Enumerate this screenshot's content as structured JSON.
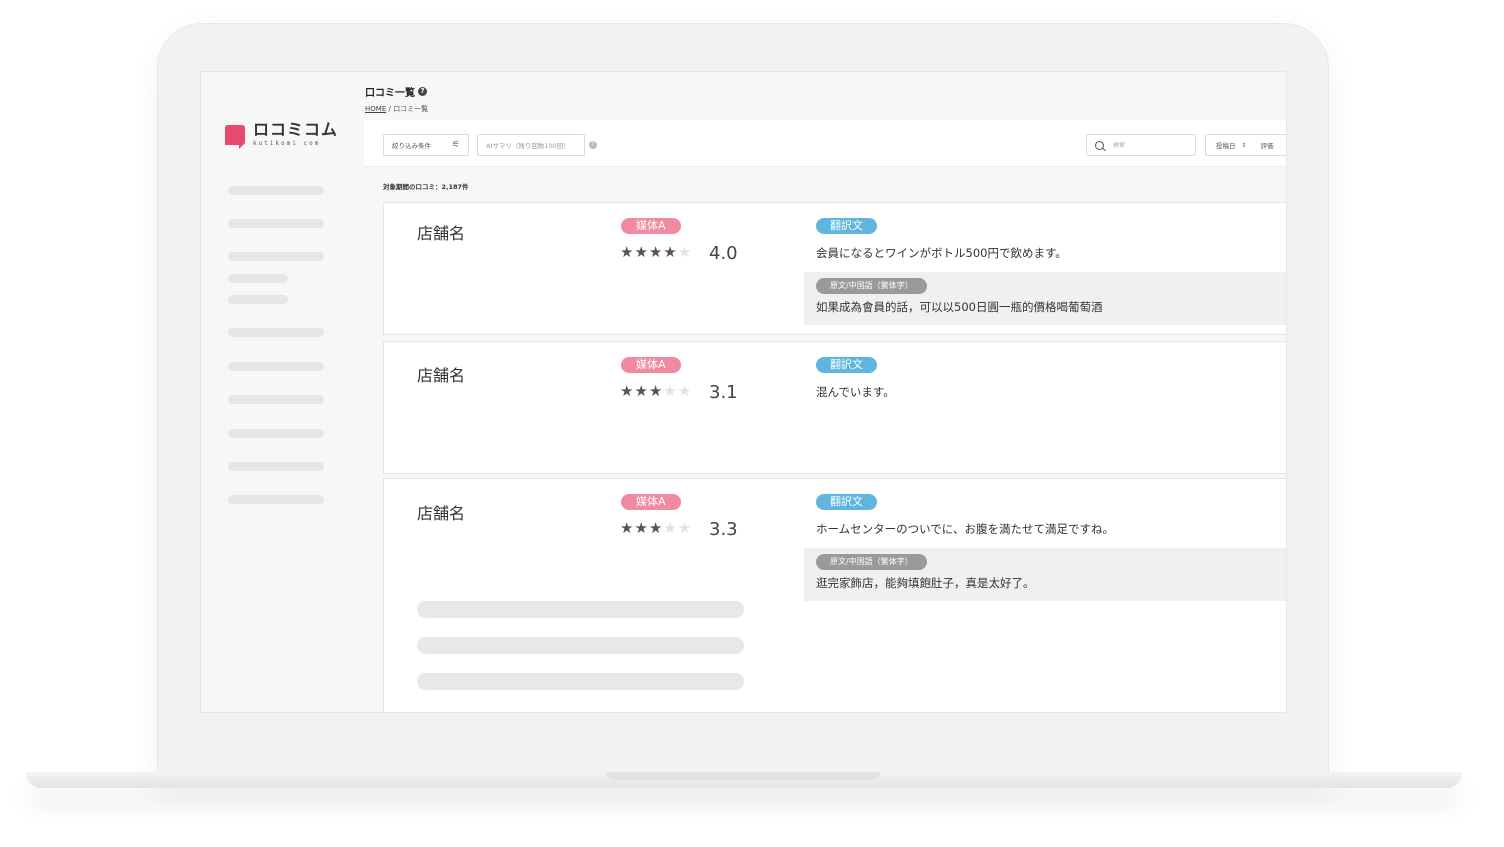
{
  "brand": {
    "logo_main": "ロコミコム",
    "logo_sub": "kutikomi com",
    "accent": "#e84a6f"
  },
  "header": {
    "title": "口コミ一覧",
    "help_icon": "?",
    "breadcrumb_home": "HOME",
    "breadcrumb_sep": "/",
    "breadcrumb_current": "口コミ一覧"
  },
  "toolbar": {
    "filter_label": "絞り込み条件",
    "filter_icon": "⚟",
    "ai_summary_label": "AIサマリ（残り回数100回）",
    "ai_help_icon": "?",
    "search_placeholder": "検索",
    "sort_label": "投稿日",
    "sort_arrows": "⇕",
    "sort_rating": "評価"
  },
  "content": {
    "count_label": "対象期間の口コミ：2,187件"
  },
  "reviews": [
    {
      "shop": "店舗名",
      "media": "媒体A",
      "rating": "4.0",
      "stars_filled": 4,
      "translation_label": "翻訳文",
      "translation": "会員になるとワインがボトル500円で飲めます。",
      "original_label": "原文/中国語（繁体字）",
      "original": "如果成為會員的話，可以以500日圓一瓶的價格喝葡萄酒"
    },
    {
      "shop": "店舗名",
      "media": "媒体A",
      "rating": "3.1",
      "stars_filled": 3,
      "translation_label": "翻訳文",
      "translation": "混んでいます。"
    },
    {
      "shop": "店舗名",
      "media": "媒体A",
      "rating": "3.3",
      "stars_filled": 3,
      "translation_label": "翻訳文",
      "translation": "ホームセンターのついでに、お腹を満たせて満足ですね。",
      "original_label": "原文/中国語（繁体字）",
      "original": "逛完家飾店，能夠填飽肚子，真是太好了。"
    }
  ],
  "colors": {
    "media_badge": "#f08aa0",
    "translation_badge": "#5fb5dd",
    "original_badge": "#9a9a9a"
  }
}
